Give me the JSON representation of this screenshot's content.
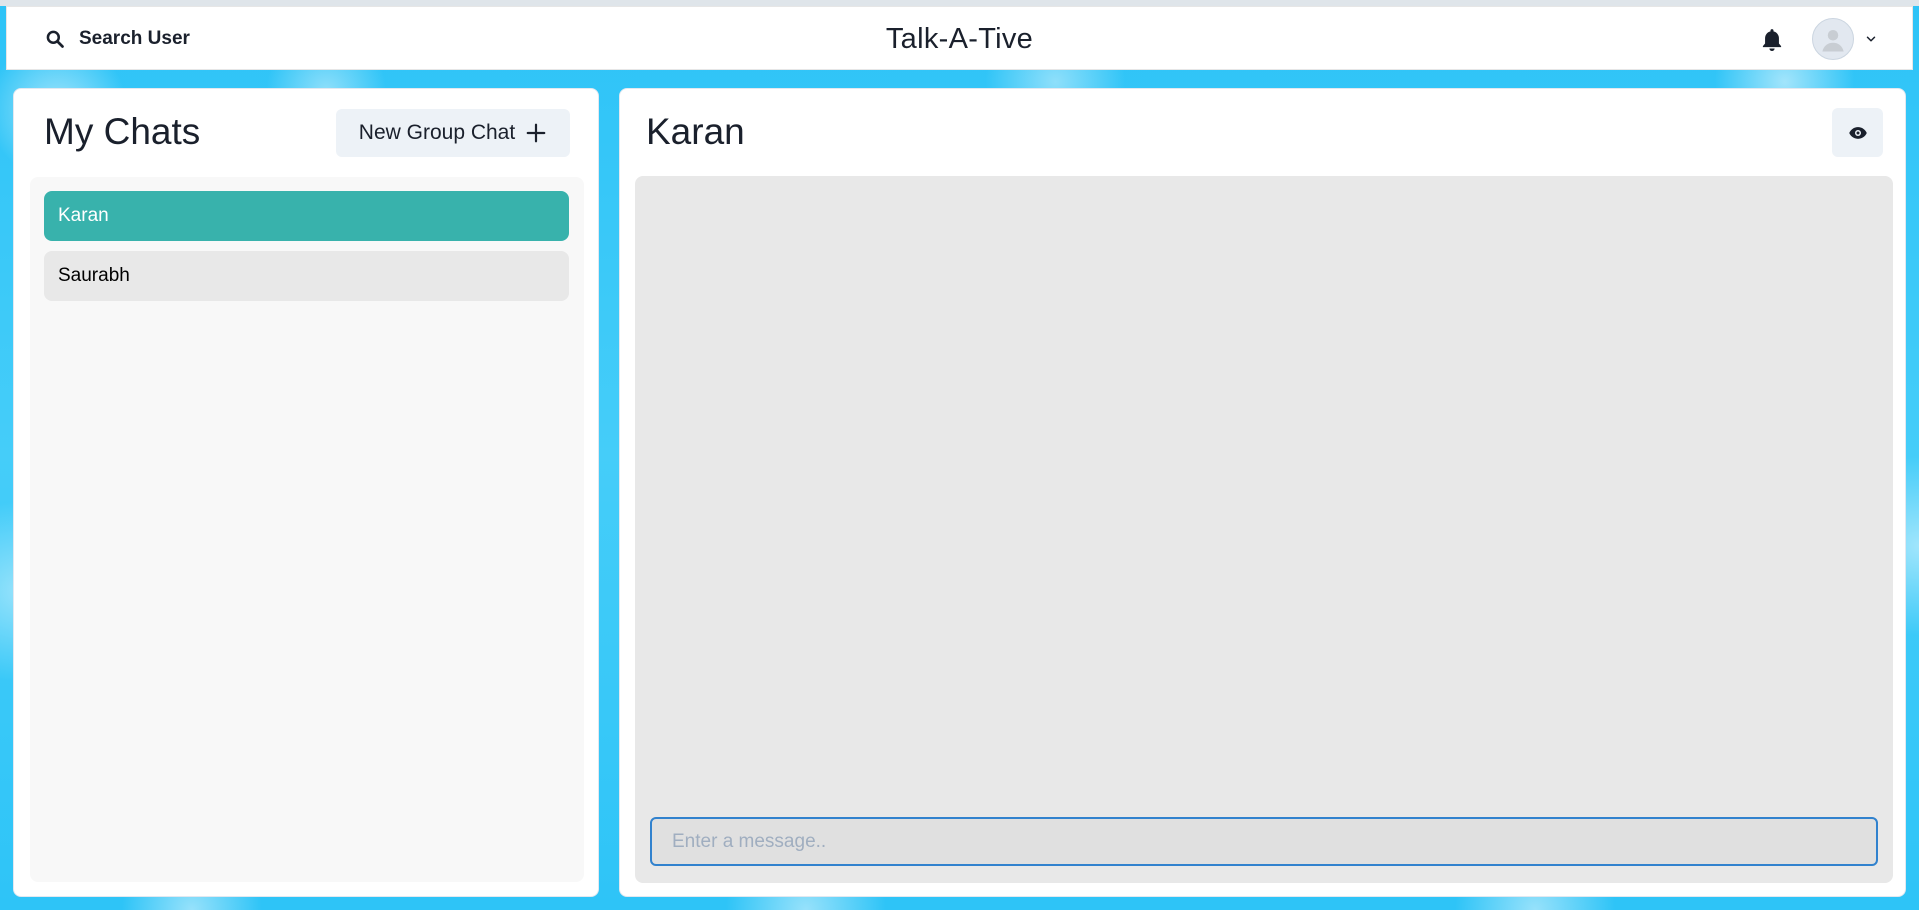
{
  "header": {
    "search_label": "Search User",
    "app_title": "Talk-A-Tive",
    "icons": {
      "search": "search-icon",
      "notifications": "bell-icon",
      "avatar": "user-avatar-icon",
      "menu": "chevron-down-icon"
    }
  },
  "sidebar": {
    "title": "My Chats",
    "new_group_label": "New Group Chat",
    "chats": [
      {
        "name": "Karan",
        "active": true
      },
      {
        "name": "Saurabh",
        "active": false
      }
    ]
  },
  "chat": {
    "name": "Karan",
    "input_placeholder": "Enter a message..",
    "input_value": ""
  },
  "colors": {
    "active_chat": "#38b2ac",
    "input_focus": "#3182ce",
    "background": "#2ec4f7"
  }
}
